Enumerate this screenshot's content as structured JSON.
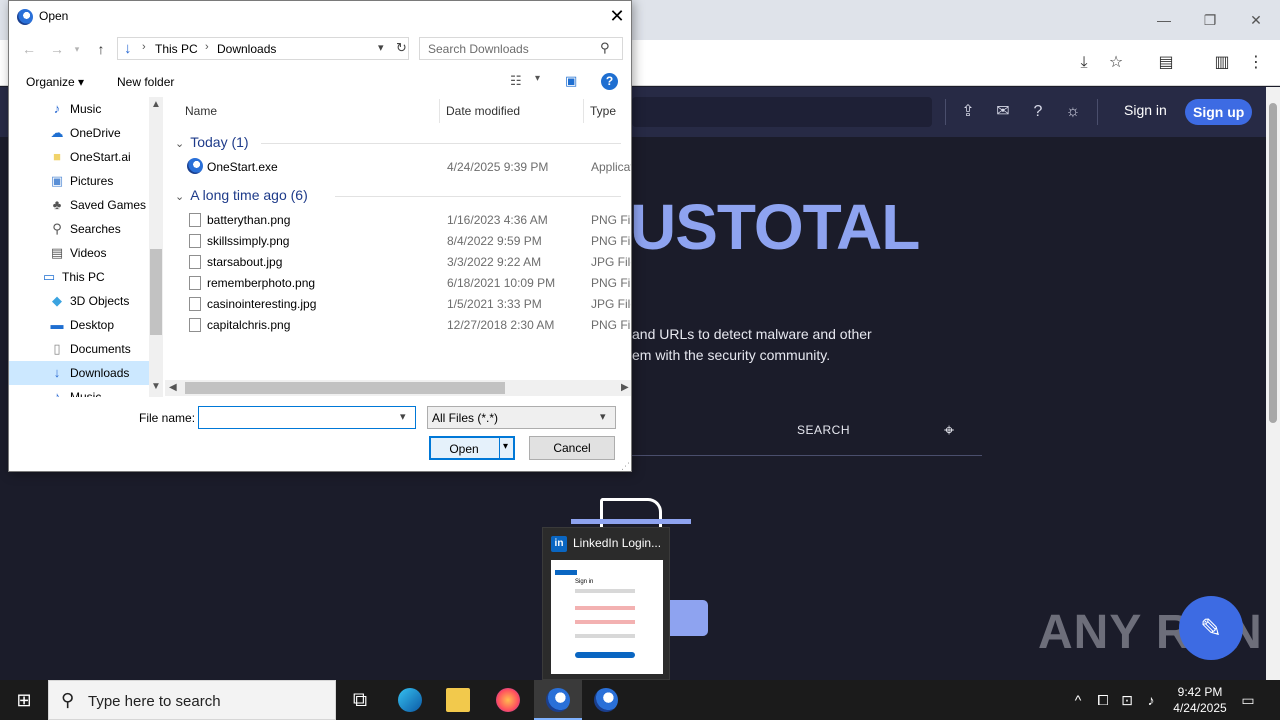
{
  "browser": {
    "window_controls": [
      "—",
      "❐",
      "✕"
    ],
    "toolbar_icons": [
      "install-icon",
      "star-icon",
      "pdf-icon",
      "sidepanel-icon",
      "menu-icon"
    ]
  },
  "virustotal": {
    "signin": "Sign in",
    "signup": "Sign up",
    "logo_fragment": "USTOTAL",
    "desc_line1": "and URLs to detect malware and other",
    "desc_line2": "em with the security community.",
    "search_tab": "SEARCH"
  },
  "watermark": "ANY RUN",
  "preview": {
    "title": "LinkedIn Login...",
    "li": "in",
    "sign_in": "Sign in"
  },
  "dialog": {
    "title": "Open",
    "breadcrumb": [
      "This PC",
      "Downloads"
    ],
    "search_placeholder": "Search Downloads",
    "organize": "Organize ▾",
    "new_folder": "New folder",
    "help": "?",
    "nav_items": [
      {
        "label": "Music",
        "icon": "♪",
        "color": "#2a6ad3"
      },
      {
        "label": "OneDrive",
        "icon": "☁",
        "color": "#1f6fd1"
      },
      {
        "label": "OneStart.ai",
        "icon": "■",
        "color": "#f1d36a"
      },
      {
        "label": "Pictures",
        "icon": "▣",
        "color": "#5a8fd6"
      },
      {
        "label": "Saved Games",
        "icon": "♣",
        "color": "#555"
      },
      {
        "label": "Searches",
        "icon": "⚲",
        "color": "#555"
      },
      {
        "label": "Videos",
        "icon": "▤",
        "color": "#555"
      },
      {
        "label": "This PC",
        "icon": "▭",
        "color": "#1f6fd1"
      },
      {
        "label": "3D Objects",
        "icon": "◆",
        "color": "#3aa3e0"
      },
      {
        "label": "Desktop",
        "icon": "▬",
        "color": "#1f6fd1"
      },
      {
        "label": "Documents",
        "icon": "▯",
        "color": "#888"
      },
      {
        "label": "Downloads",
        "icon": "↓",
        "color": "#2a6ad3"
      },
      {
        "label": "Music",
        "icon": "♪",
        "color": "#2a6ad3"
      }
    ],
    "columns": {
      "name": "Name",
      "date": "Date modified",
      "type": "Type"
    },
    "groups": [
      {
        "label": "Today (1)"
      },
      {
        "label": "A long time ago (6)"
      }
    ],
    "files_today": [
      {
        "name": "OneStart.exe",
        "date": "4/24/2025 9:39 PM",
        "type": "Applicat"
      }
    ],
    "files_old": [
      {
        "name": "batterythan.png",
        "date": "1/16/2023 4:36 AM",
        "type": "PNG File"
      },
      {
        "name": "skillssimply.png",
        "date": "8/4/2022 9:59 PM",
        "type": "PNG File"
      },
      {
        "name": "starsabout.jpg",
        "date": "3/3/2022 9:22 AM",
        "type": "JPG File"
      },
      {
        "name": "rememberphoto.png",
        "date": "6/18/2021 10:09 PM",
        "type": "PNG File"
      },
      {
        "name": "casinointeresting.jpg",
        "date": "1/5/2021 3:33 PM",
        "type": "JPG File"
      },
      {
        "name": "capitalchris.png",
        "date": "12/27/2018 2:30 AM",
        "type": "PNG File"
      }
    ],
    "file_name_label": "File name:",
    "file_name_value": "",
    "filter": "All Files (*.*)",
    "open": "Open",
    "cancel": "Cancel"
  },
  "taskbar": {
    "search_placeholder": "Type here to search",
    "time": "9:42 PM",
    "date": "4/24/2025"
  }
}
